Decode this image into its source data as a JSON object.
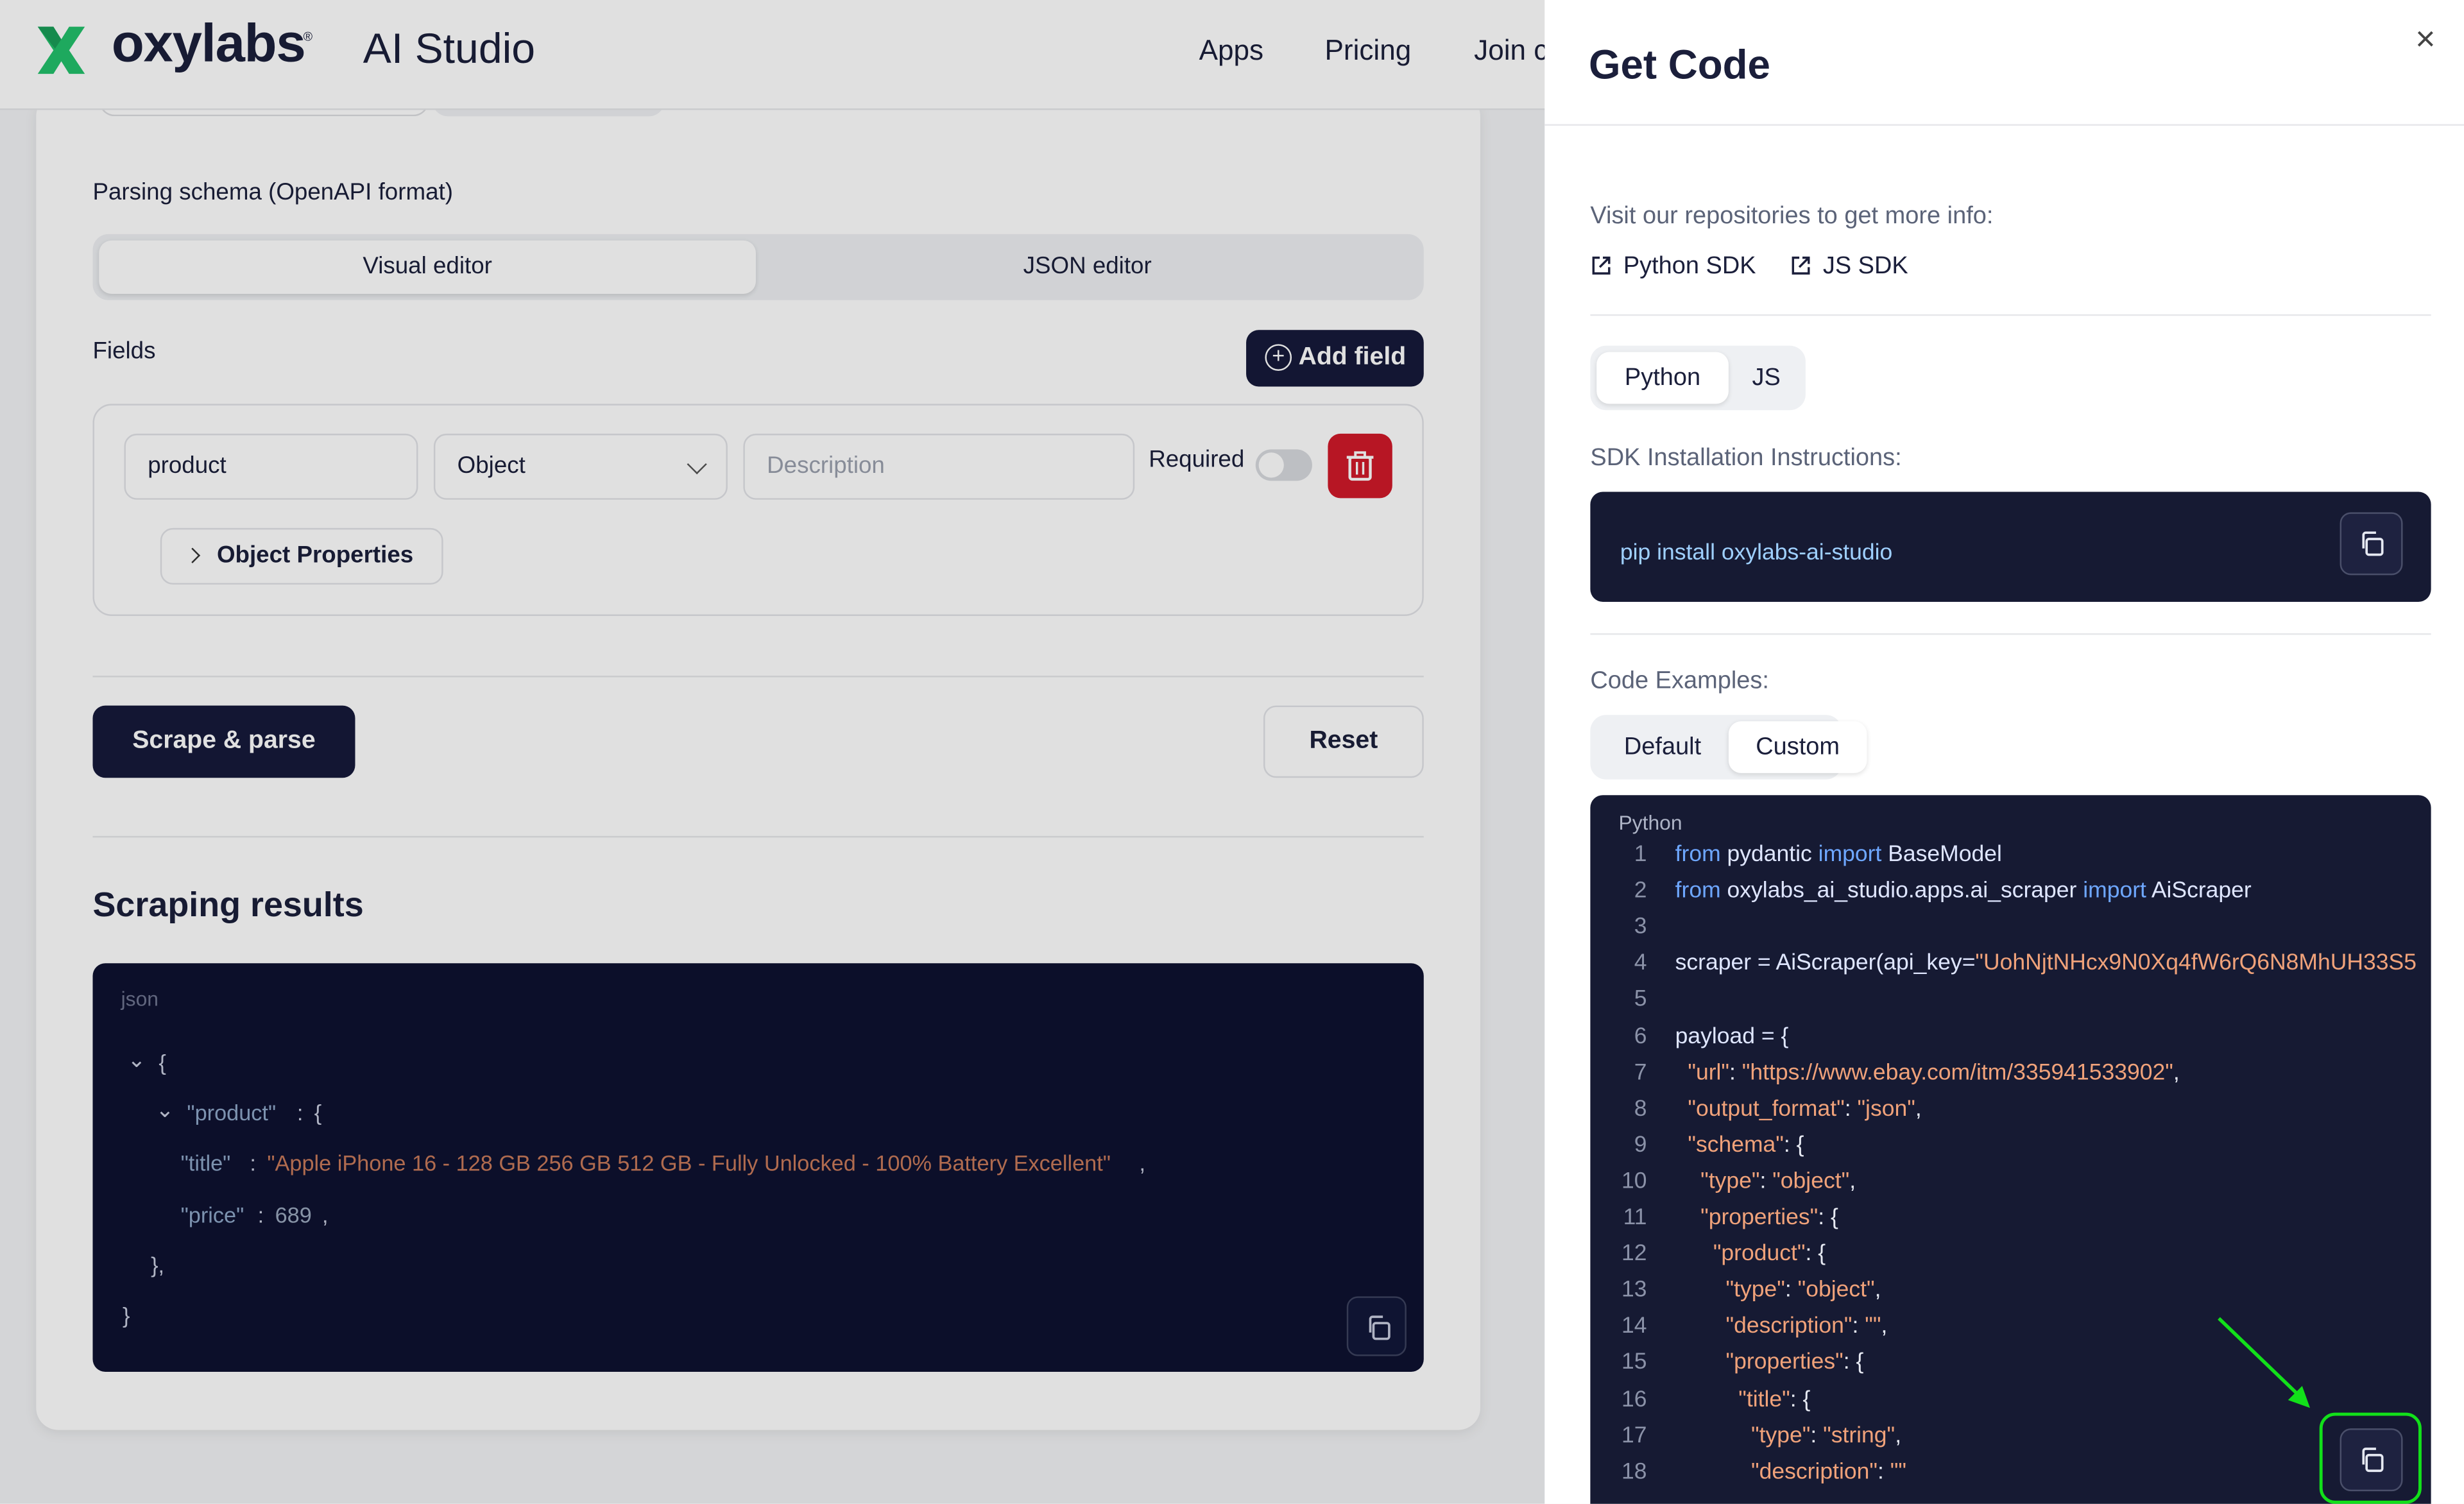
{
  "header": {
    "brand": "oxylabs",
    "reg_mark": "®",
    "product": "AI Studio",
    "nav": [
      "Apps",
      "Pricing",
      "Join c"
    ]
  },
  "form": {
    "schema_label": "Parsing schema (OpenAPI format)",
    "editor_tabs": [
      "Visual editor",
      "JSON editor"
    ],
    "active_editor": "Visual editor",
    "fields_label": "Fields",
    "add_field": "Add field",
    "field": {
      "name": "product",
      "type": "Object",
      "description_placeholder": "Description",
      "required_label": "Required",
      "required": false
    },
    "object_properties": "Object Properties",
    "scrape_button": "Scrape & parse",
    "reset_button": "Reset"
  },
  "results": {
    "title": "Scraping results",
    "lang": "json",
    "lines": {
      "open": "{",
      "product_key": "\"product\"",
      "product_sep": ":",
      "product_open": "{",
      "title_key": "\"title\"",
      "title_sep": ":",
      "title_val": "\"Apple iPhone 16 - 128 GB 256 GB 512 GB - Fully Unlocked - 100% Battery Excellent\"",
      "title_comma": ",",
      "price_key": "\"price\"",
      "price_sep": ":",
      "price_val": "689",
      "price_comma": ",",
      "inner_close": "},",
      "close": "}"
    }
  },
  "drawer": {
    "title": "Get Code",
    "close": "×",
    "repos_label": "Visit our repositories to get more info:",
    "links": [
      "Python SDK",
      "JS SDK"
    ],
    "lang_tabs": [
      "Python",
      "JS"
    ],
    "active_lang": "Python",
    "install_label": "SDK Installation Instructions:",
    "install_cmd": "pip install oxylabs-ai-studio",
    "examples_label": "Code Examples:",
    "example_tabs": [
      "Default",
      "Custom"
    ],
    "active_example": "Custom",
    "code_lang": "Python",
    "code_lines": [
      {
        "n": "1",
        "parts": [
          [
            "kw",
            "from"
          ],
          [
            "id",
            " pydantic "
          ],
          [
            "kw",
            "import"
          ],
          [
            "id",
            " BaseModel"
          ]
        ]
      },
      {
        "n": "2",
        "parts": [
          [
            "kw",
            "from"
          ],
          [
            "id",
            " oxylabs_ai_studio.apps.ai_scraper "
          ],
          [
            "kw",
            "import"
          ],
          [
            "id",
            " AiScraper"
          ]
        ]
      },
      {
        "n": "3",
        "parts": []
      },
      {
        "n": "4",
        "parts": [
          [
            "id",
            "scraper = AiScraper(api_key="
          ],
          [
            "str",
            "\"UohNjtNHcx9N0Xq4fW6rQ6N8MhUH33S5"
          ]
        ]
      },
      {
        "n": "5",
        "parts": []
      },
      {
        "n": "6",
        "parts": [
          [
            "id",
            "payload = {"
          ]
        ]
      },
      {
        "n": "7",
        "parts": [
          [
            "str",
            "  \"url\""
          ],
          [
            "pun",
            ": "
          ],
          [
            "str",
            "\"https://www.ebay.com/itm/335941533902\""
          ],
          [
            "pun",
            ","
          ]
        ]
      },
      {
        "n": "8",
        "parts": [
          [
            "str",
            "  \"output_format\""
          ],
          [
            "pun",
            ": "
          ],
          [
            "str",
            "\"json\""
          ],
          [
            "pun",
            ","
          ]
        ]
      },
      {
        "n": "9",
        "parts": [
          [
            "str",
            "  \"schema\""
          ],
          [
            "pun",
            ": {"
          ]
        ]
      },
      {
        "n": "10",
        "parts": [
          [
            "str",
            "    \"type\""
          ],
          [
            "pun",
            ": "
          ],
          [
            "str",
            "\"object\""
          ],
          [
            "pun",
            ","
          ]
        ]
      },
      {
        "n": "11",
        "parts": [
          [
            "str",
            "    \"properties\""
          ],
          [
            "pun",
            ": {"
          ]
        ]
      },
      {
        "n": "12",
        "parts": [
          [
            "str",
            "      \"product\""
          ],
          [
            "pun",
            ": {"
          ]
        ]
      },
      {
        "n": "13",
        "parts": [
          [
            "str",
            "        \"type\""
          ],
          [
            "pun",
            ": "
          ],
          [
            "str",
            "\"object\""
          ],
          [
            "pun",
            ","
          ]
        ]
      },
      {
        "n": "14",
        "parts": [
          [
            "str",
            "        \"description\""
          ],
          [
            "pun",
            ": "
          ],
          [
            "str",
            "\"\""
          ],
          [
            "pun",
            ","
          ]
        ]
      },
      {
        "n": "15",
        "parts": [
          [
            "str",
            "        \"properties\""
          ],
          [
            "pun",
            ": {"
          ]
        ]
      },
      {
        "n": "16",
        "parts": [
          [
            "str",
            "          \"title\""
          ],
          [
            "pun",
            ": {"
          ]
        ]
      },
      {
        "n": "17",
        "parts": [
          [
            "str",
            "            \"type\""
          ],
          [
            "pun",
            ": "
          ],
          [
            "str",
            "\"string\""
          ],
          [
            "pun",
            ","
          ]
        ]
      },
      {
        "n": "18",
        "parts": [
          [
            "str",
            "            \"description\""
          ],
          [
            "pun",
            ": "
          ],
          [
            "str",
            "\"\""
          ]
        ]
      }
    ]
  },
  "icons": [
    "copy-icon",
    "external-link-icon",
    "trash-icon",
    "plus-circle-icon",
    "chevron-down-icon",
    "chevron-right-icon",
    "close-icon",
    "oxylabs-logo-icon"
  ],
  "colors": {
    "accent_dark": "#161a3b",
    "danger": "#d11a2a",
    "highlight": "#12e01a",
    "code_bg": "#161a33"
  }
}
